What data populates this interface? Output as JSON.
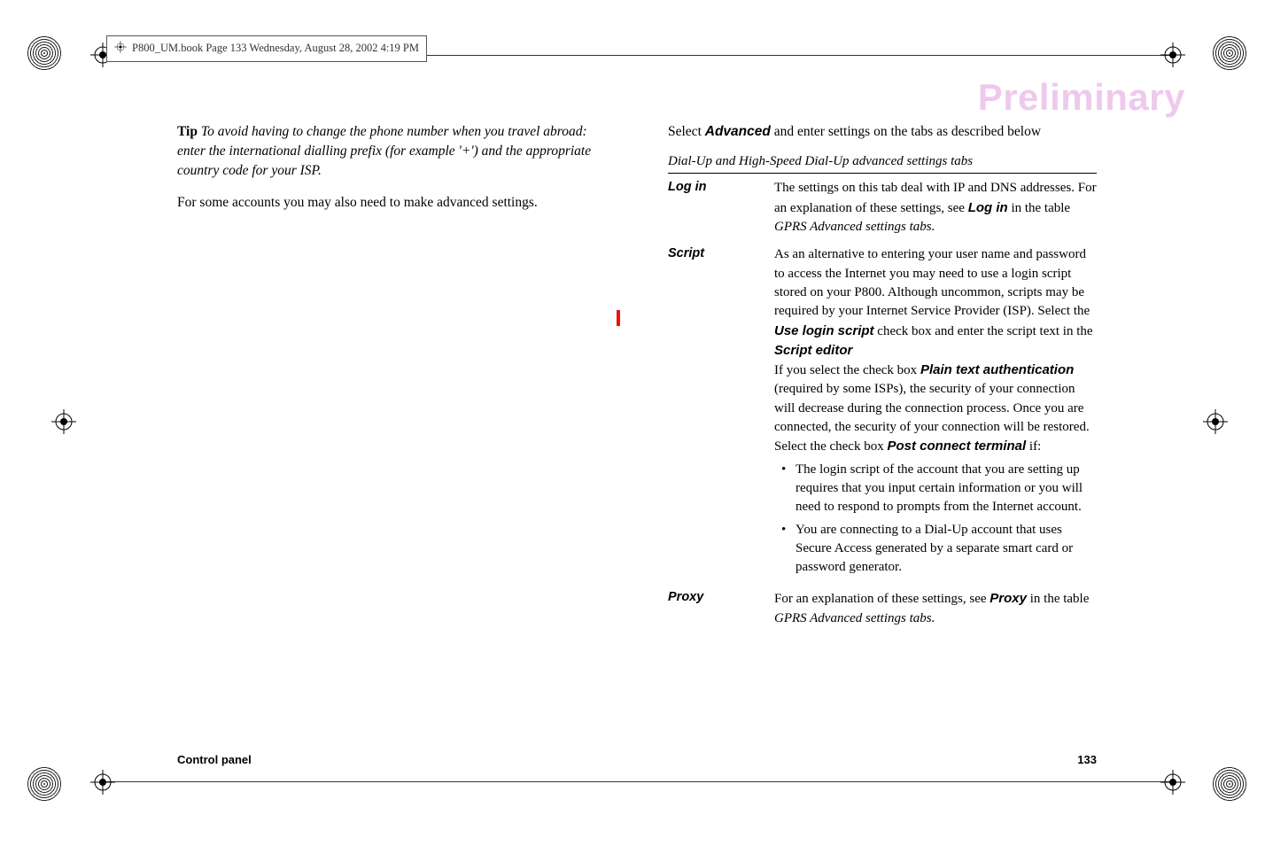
{
  "book_header": "P800_UM.book  Page 133  Wednesday, August 28, 2002  4:19 PM",
  "watermark": "Preliminary",
  "left": {
    "tip_label": "Tip",
    "tip_body": "To avoid having to change the phone number when you travel abroad: enter the international dialling prefix (for example '+') and the appropriate country code for your ISP.",
    "para2": "For some accounts you may also need to make advanced settings."
  },
  "right": {
    "intro_pre": " Select ",
    "intro_bold": "Advanced",
    "intro_post": "  and enter settings on the tabs as described below",
    "table_title": "Dial-Up and High-Speed Dial-Up advanced settings tabs",
    "rows": {
      "login": {
        "label": "Log in",
        "text_pre": "The settings on this tab deal with IP and DNS addresses. For an explanation of these settings, see ",
        "bold": "Log in",
        "text_mid": " in the table ",
        "italic": "GPRS Advanced settings tabs."
      },
      "script": {
        "label": "Script",
        "p1_pre": "As an alternative to entering your user name and password to access the Internet you may need to use a login script stored on your P800. Although uncommon, scripts may be required by your Internet Service Provider (ISP). Select the ",
        "p1_b1": "Use login script",
        "p1_mid1": " check box and enter the script text in the ",
        "p1_b2": "Script editor",
        "p2_pre": "If you select the check box ",
        "p2_b1": "Plain text authentication",
        "p2_post": " (required by some ISPs), the security of your connection will decrease during the connection process. Once you are connected, the security of your connection will be restored.",
        "p3_pre": "Select the check box ",
        "p3_b1": "Post connect terminal",
        "p3_post": " if:",
        "li1": "The login script of the account that you are setting up requires that you input certain information or you will need to respond to prompts from the Internet account.",
        "li2": "You are connecting to a Dial-Up account that uses Secure Access generated by a separate smart card or password generator."
      },
      "proxy": {
        "label": "Proxy",
        "text_pre": " For an explanation of these settings, see ",
        "bold": "Proxy",
        "text_mid": " in the table ",
        "italic": "GPRS Advanced settings tabs."
      }
    }
  },
  "footer": {
    "left": "Control panel",
    "right": "133"
  }
}
